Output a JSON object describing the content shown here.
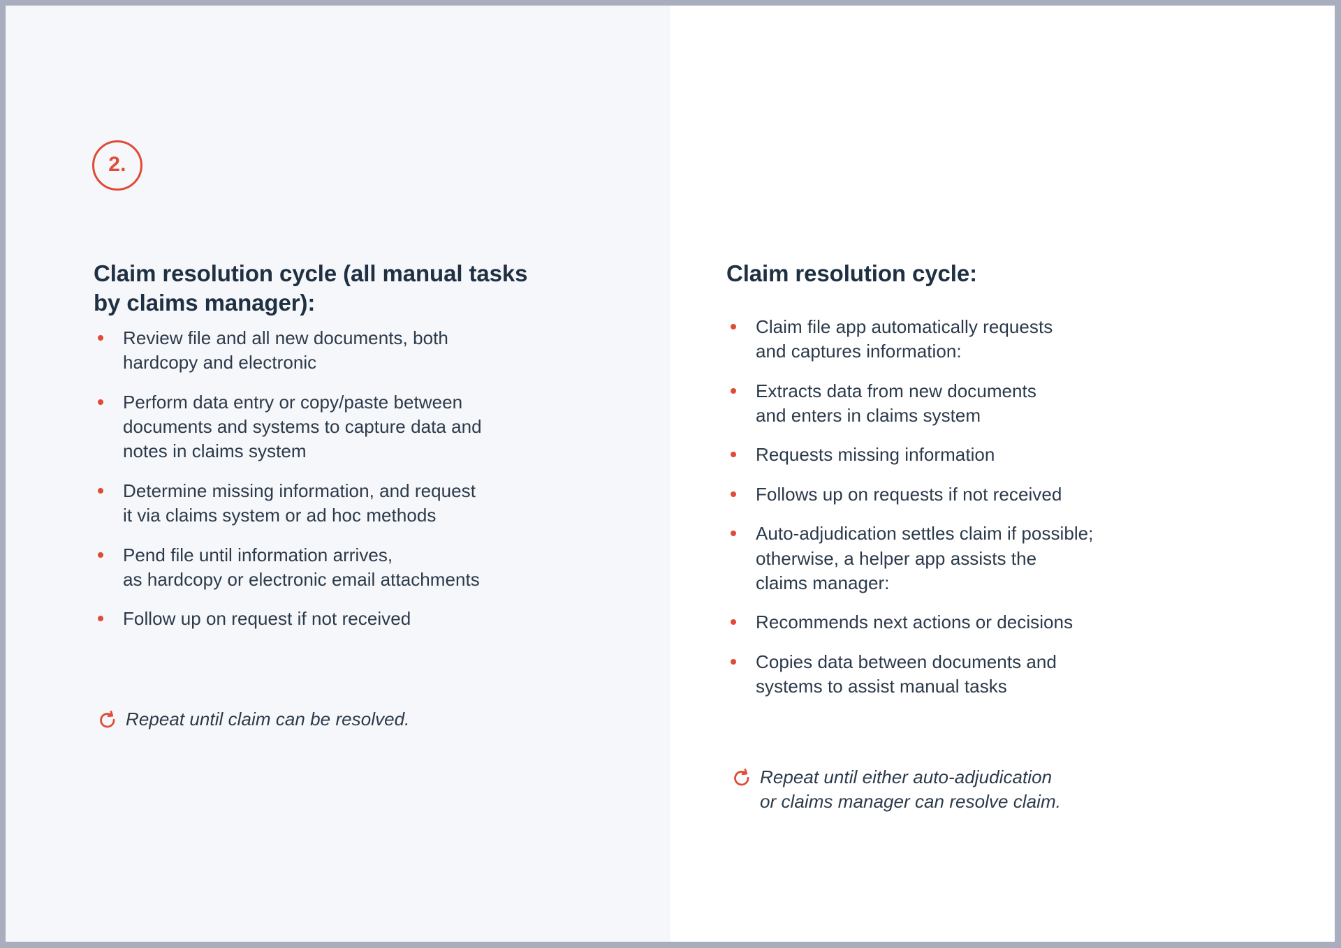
{
  "slide": {
    "step_number": "2.",
    "accent_color": "#e04a36",
    "heading_color": "#1f3043",
    "body_color": "#2b3a4a",
    "left_panel_bg": "#f6f7fa",
    "right_panel_bg": "#ffffff",
    "border_color": "#a9aebe"
  },
  "left": {
    "heading": "Claim resolution cycle (all manual tasks by claims manager):",
    "bullets": [
      "Review file and all new documents, both\nhardcopy and electronic",
      "Perform data entry or copy/paste between\ndocuments and systems to capture data and\nnotes in claims system",
      "Determine missing information, and request\nit via claims system or ad hoc methods",
      "Pend file until information arrives,\nas hardcopy or electronic email attachments",
      "Follow up on request if not received"
    ],
    "repeat_icon": "repeat-cycle-icon",
    "repeat_note": "Repeat until claim can be resolved."
  },
  "right": {
    "heading": "Claim resolution cycle:",
    "bullets": [
      "Claim file app automatically requests\nand captures information:",
      "Extracts data from new documents\nand enters in claims system",
      "Requests missing information",
      "Follows up on requests if not received",
      "Auto-adjudication settles claim if possible;\notherwise, a helper app assists the\nclaims manager:",
      "Recommends next actions or decisions",
      "Copies data between documents and\nsystems to assist manual tasks"
    ],
    "repeat_icon": "repeat-cycle-icon",
    "repeat_note": "Repeat until either auto-adjudication\nor claims manager can resolve claim."
  }
}
